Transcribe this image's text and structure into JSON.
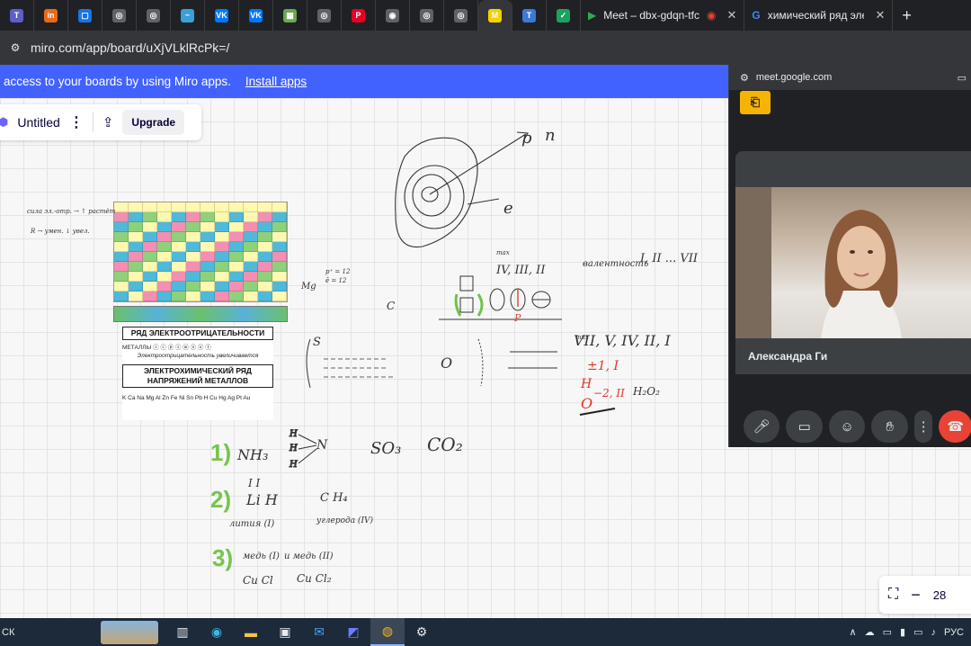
{
  "browser": {
    "tabs": [
      {
        "icon": "teams-icon",
        "color": "#5b5fc7",
        "glyph": "T"
      },
      {
        "icon": "in-icon",
        "color": "#e86a1a",
        "glyph": "in"
      },
      {
        "icon": "chat-icon",
        "color": "#1a73e8",
        "glyph": "▢"
      },
      {
        "icon": "globe-icon",
        "color": "#5f6368",
        "glyph": "◎"
      },
      {
        "icon": "globe-icon",
        "color": "#5f6368",
        "glyph": "◎"
      },
      {
        "icon": "bird-icon",
        "color": "#3aa0d8",
        "glyph": "~"
      },
      {
        "icon": "vk-icon",
        "color": "#0077ff",
        "glyph": "VK"
      },
      {
        "icon": "vk-icon",
        "color": "#0077ff",
        "glyph": "VK"
      },
      {
        "icon": "map-icon",
        "color": "#6aa84f",
        "glyph": "▦"
      },
      {
        "icon": "globe-icon",
        "color": "#5f6368",
        "glyph": "◎"
      },
      {
        "icon": "pinterest-icon",
        "color": "#e60023",
        "glyph": "P"
      },
      {
        "icon": "camera-icon",
        "color": "#5f6368",
        "glyph": "◉"
      },
      {
        "icon": "globe-icon",
        "color": "#5f6368",
        "glyph": "◎"
      },
      {
        "icon": "globe-icon",
        "color": "#5f6368",
        "glyph": "◎"
      },
      {
        "icon": "miro-icon",
        "color": "#f6d100",
        "glyph": "M",
        "active": true
      },
      {
        "icon": "text-icon",
        "color": "#3c78d8",
        "glyph": "T"
      },
      {
        "icon": "check-icon",
        "color": "#1aa260",
        "glyph": "✓"
      }
    ],
    "meet_tab_title": "Meet – dbx-gdqn-tfc",
    "search_tab_title": "химический ряд электр",
    "url": "miro.com/app/board/uXjVLklRcPk=/"
  },
  "banner": {
    "text": "access to your boards by using Miro apps.",
    "link": "Install apps"
  },
  "miro": {
    "board_title": "Untitled",
    "upgrade_label": "Upgrade",
    "zoom_label": "28"
  },
  "board_text": {
    "nucleus_p": "p",
    "nucleus_n": "n",
    "electron": "e",
    "valence": "валентность",
    "valence_values": "I, II ... VII",
    "max_label": "max",
    "roman_seq_top": "IV, III, II",
    "roman_seq_max": "VII, V, IV, II, I",
    "ox_plus_minus": "±1, I",
    "ox_h": "H",
    "ox_o": "O",
    "ox_o_val": "−2, II",
    "h2o2": "H₂O₂",
    "s_label": "S",
    "d8": "O",
    "carbon": "C",
    "mg": "Mg",
    "nh3": "NH₃",
    "so3": "SO₃",
    "co2": "CO₂",
    "lih": "Li H",
    "ch4": "C H₄",
    "lithium_label": "лития (I)",
    "carbon_label": "углерода (IV)",
    "copper1_label": "медь (I)",
    "copper2_label": "и медь (II)",
    "cucl": "Cu Cl",
    "cucl2": "Cu Cl₂",
    "num1": "1)",
    "num2": "2)",
    "num3": "3)",
    "left_note1": "сила эл.-отр. → ↑ растёт",
    "left_note2": "R → умен. ↓ увел.",
    "p_number": "p⁺ = 12",
    "e_number": "ē = 12"
  },
  "series_image": {
    "title1": "РЯД ЭЛЕКТРООТРИЦАТЕЛЬНОСТИ",
    "metals_label": "МЕТАЛЛЫ",
    "line1": "Электроотрицательность увеличивается",
    "title2": "ЭЛЕКТРОХИМИЧЕСКИЙ РЯД НАПРЯЖЕНИЙ МЕТАЛЛОВ",
    "metals_row": "K Ca Na Mg Al Zn Fe Ni Sn Pb H Cu Hg Ag Pt Au"
  },
  "meet": {
    "domain": "meet.google.com",
    "participant": "Александра Ги"
  },
  "taskbar": {
    "search_label": "СК",
    "lang": "РУС"
  }
}
